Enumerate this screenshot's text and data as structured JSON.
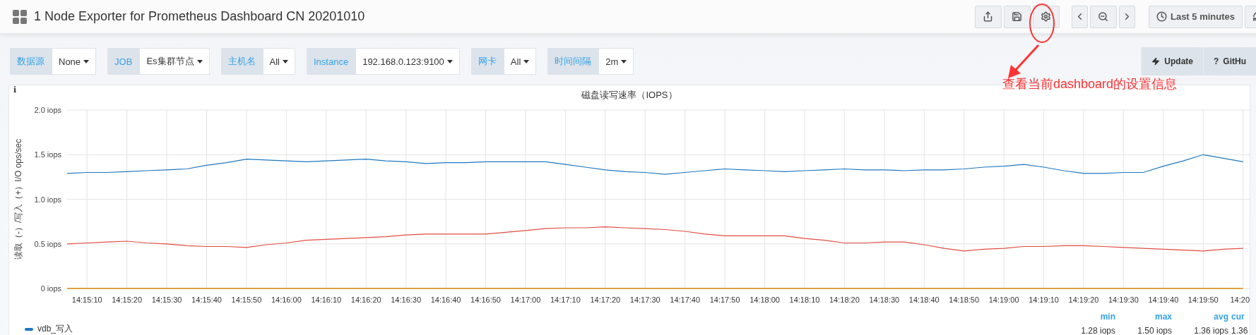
{
  "header": {
    "title": "1 Node Exporter for Prometheus Dashboard CN 20201010",
    "toolbar": [
      {
        "kind": "share"
      },
      {
        "kind": "save"
      },
      {
        "kind": "settings"
      },
      {
        "kind": "back"
      },
      {
        "kind": "zoom_out"
      },
      {
        "kind": "forward"
      },
      {
        "kind": "time",
        "label": "Last 5 minutes"
      },
      {
        "kind": "refresh"
      }
    ]
  },
  "variables": [
    {
      "label": "数据源",
      "value": "None"
    },
    {
      "label": "JOB",
      "value": "Es集群节点"
    },
    {
      "label": "主机名",
      "value": "All"
    },
    {
      "label": "Instance",
      "value": "192.168.0.123:9100"
    },
    {
      "label": "网卡",
      "value": "All"
    },
    {
      "label": "时间间隔",
      "value": "2m"
    }
  ],
  "links": [
    {
      "kind": "update",
      "label": "Update"
    },
    {
      "kind": "help",
      "icon_text": "?",
      "label": "GitHu"
    }
  ],
  "panel": {
    "info": "i",
    "title": "磁盘读写速率（IOPS）",
    "chart_data": {
      "type": "line",
      "ylabel": "读取（-）/写入（+）I/O ops/sec",
      "categories": [
        null,
        "14:15:10",
        null,
        "14:15:20",
        null,
        "14:15:30",
        null,
        "14:15:40",
        null,
        "14:15:50",
        null,
        "14:16:00",
        null,
        "14:16:10",
        null,
        "14:16:20",
        null,
        "14:16:30",
        null,
        "14:16:40",
        null,
        "14:16:50",
        null,
        "14:17:00",
        null,
        "14:17:10",
        null,
        "14:17:20",
        null,
        "14:17:30",
        null,
        "14:17:40",
        null,
        "14:17:50",
        null,
        "14:18:00",
        null,
        "14:18:10",
        null,
        "14:18:20",
        null,
        "14:18:30",
        null,
        "14:18:40",
        null,
        "14:18:50",
        null,
        "14:19:00",
        null,
        "14:19:10",
        null,
        "14:19:20",
        null,
        "14:19:30",
        null,
        "14:19:40",
        null,
        "14:19:50",
        null,
        "14:20"
      ],
      "series": [
        {
          "color": "#1f78c1",
          "values": [
            1.29,
            1.3,
            1.3,
            1.31,
            1.32,
            1.33,
            1.34,
            1.38,
            1.41,
            1.45,
            1.44,
            1.43,
            1.42,
            1.43,
            1.44,
            1.45,
            1.43,
            1.42,
            1.4,
            1.41,
            1.41,
            1.42,
            1.42,
            1.42,
            1.42,
            1.39,
            1.36,
            1.33,
            1.31,
            1.3,
            1.28,
            1.3,
            1.32,
            1.34,
            1.33,
            1.32,
            1.31,
            1.32,
            1.33,
            1.34,
            1.33,
            1.33,
            1.32,
            1.33,
            1.33,
            1.34,
            1.36,
            1.37,
            1.39,
            1.36,
            1.32,
            1.29,
            1.29,
            1.3,
            1.3,
            1.37,
            1.43,
            1.5,
            1.46,
            1.42
          ]
        },
        {
          "color": "#e24d42",
          "values": [
            0.5,
            0.51,
            0.52,
            0.53,
            0.51,
            0.5,
            0.48,
            0.47,
            0.47,
            0.46,
            0.49,
            0.51,
            0.54,
            0.55,
            0.56,
            0.57,
            0.58,
            0.6,
            0.61,
            0.61,
            0.61,
            0.61,
            0.63,
            0.65,
            0.67,
            0.68,
            0.68,
            0.69,
            0.68,
            0.67,
            0.66,
            0.64,
            0.61,
            0.59,
            0.59,
            0.59,
            0.59,
            0.56,
            0.54,
            0.51,
            0.51,
            0.52,
            0.52,
            0.49,
            0.45,
            0.42,
            0.44,
            0.45,
            0.47,
            0.47,
            0.48,
            0.48,
            0.47,
            0.46,
            0.45,
            0.44,
            0.43,
            0.42,
            0.44,
            0.45
          ]
        },
        {
          "color": "#e0a042",
          "values": [
            0,
            0,
            0,
            0,
            0,
            0,
            0,
            0,
            0,
            0,
            0,
            0,
            0,
            0,
            0,
            0,
            0,
            0,
            0,
            0,
            0,
            0,
            0,
            0,
            0,
            0,
            0,
            0,
            0,
            0,
            0,
            0,
            0,
            0,
            0,
            0,
            0,
            0,
            0,
            0,
            0,
            0,
            0,
            0,
            0,
            0,
            0,
            0,
            0,
            0,
            0,
            0,
            0,
            0,
            0,
            0,
            0,
            0,
            0,
            0
          ]
        }
      ],
      "ylim": [
        0,
        2
      ],
      "grid": true,
      "yticks": [
        {
          "value": 0,
          "label": "0 iops"
        },
        {
          "value": 0.5,
          "label": "0.5 iops"
        },
        {
          "value": 1,
          "label": "1.0 iops"
        },
        {
          "value": 1.5,
          "label": "1.5 iops"
        },
        {
          "value": 2,
          "label": "2.0 iops"
        }
      ]
    },
    "legend": {
      "columns": [
        "min",
        "max",
        "avg",
        "cur"
      ],
      "items": [
        {
          "name": "vdb_写入",
          "color": "#1f78c1",
          "values": [
            "1.28 iops",
            "1.50 iops",
            "1.36 iops",
            "1.36"
          ]
        }
      ]
    }
  },
  "annotation": {
    "text": "查看当前dashboard的设置信息"
  }
}
